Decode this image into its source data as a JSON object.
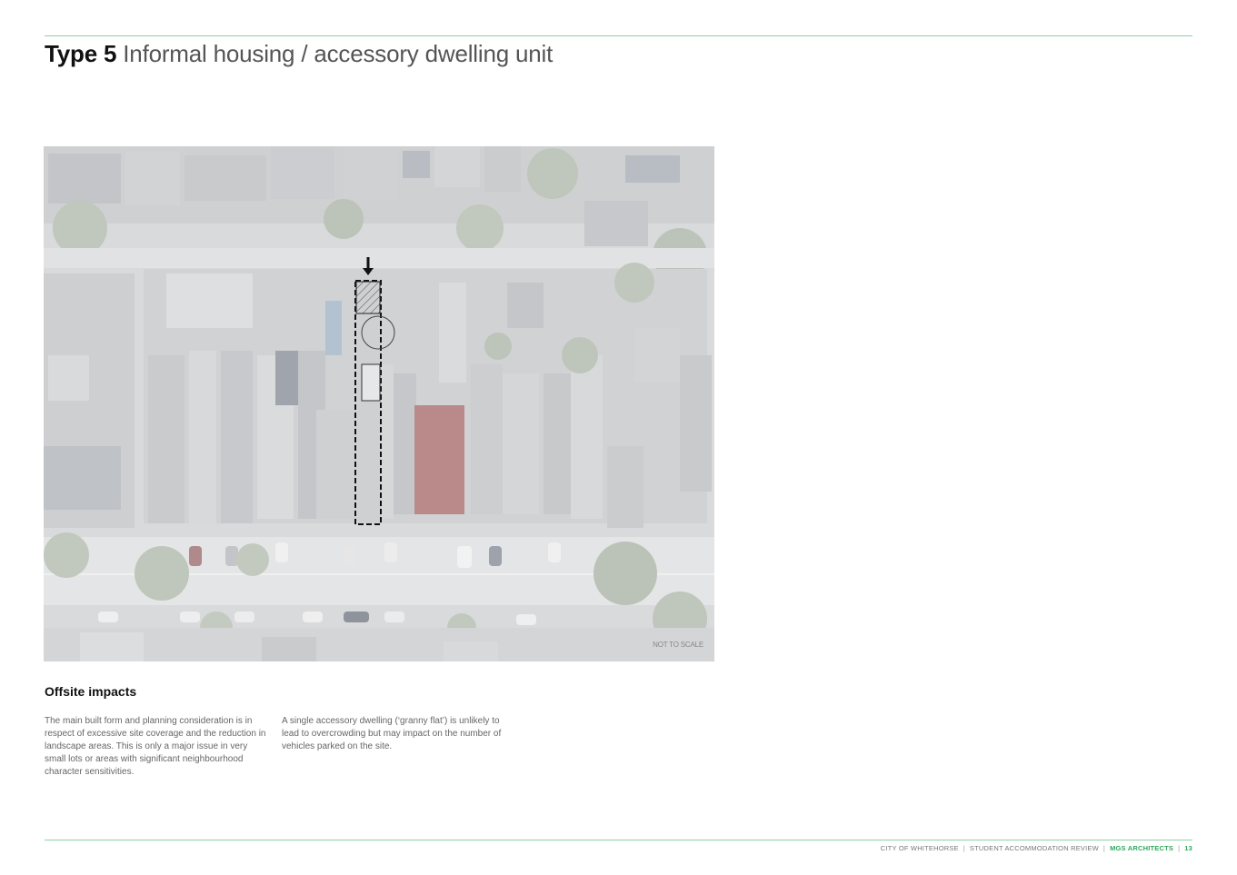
{
  "header": {
    "type_label": "Type 5",
    "title": "Informal housing / accessory dwelling unit"
  },
  "figure": {
    "scale_note": "NOT TO SCALE"
  },
  "section": {
    "heading": "Offsite impacts",
    "col_left": "The main built form and planning consideration is in respect of excessive site coverage and the reduction in landscape areas. This is only a major issue in very small lots or areas with significant neighbourhood character sensitivities.",
    "col_right": "A single accessory dwelling (‘granny flat’) is unlikely to lead to overcrowding but may impact on the number of vehicles parked on the site."
  },
  "footer": {
    "client": "CITY OF WHITEHORSE",
    "report": "STUDENT ACCOMMODATION REVIEW",
    "firm": "MGS ARCHITECTS",
    "page": "13"
  }
}
